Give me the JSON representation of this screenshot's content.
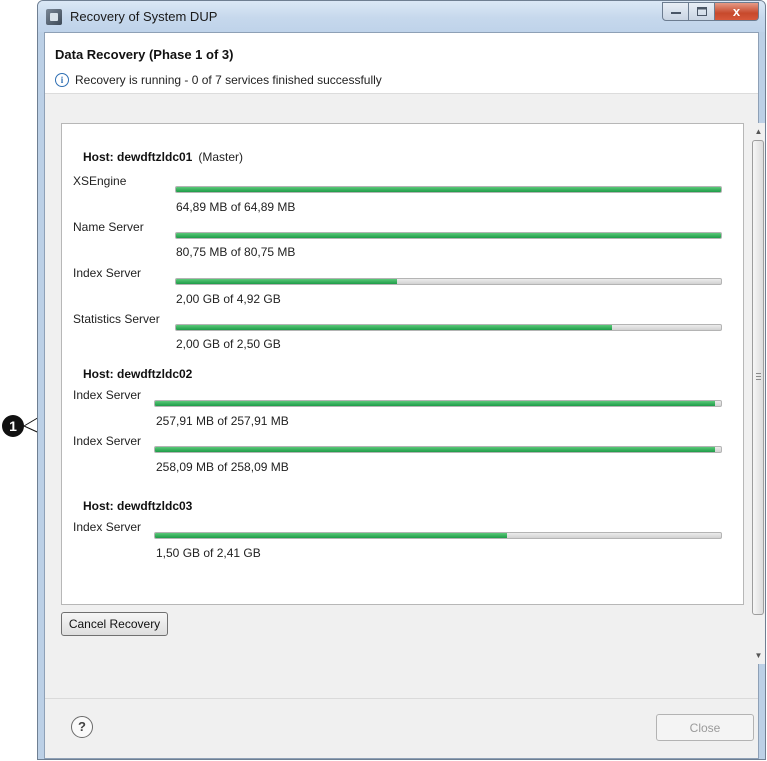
{
  "window": {
    "title": "Recovery of System DUP"
  },
  "header": {
    "title": "Data Recovery (Phase 1 of 3)",
    "message": "Recovery is running - 0 of 7 services finished successfully"
  },
  "callout": {
    "label": "1"
  },
  "hosts": [
    {
      "title": "Host: dewdftzldc01",
      "role": "(Master)",
      "services": [
        {
          "name": "XSEngine",
          "amount": "64,89 MB of 64,89 MB",
          "progress": 1.0
        },
        {
          "name": "Name Server",
          "amount": "80,75 MB of 80,75 MB",
          "progress": 1.0
        },
        {
          "name": "Index Server",
          "amount": "2,00 GB of 4,92 GB",
          "progress": 0.406
        },
        {
          "name": "Statistics Server",
          "amount": "2,00 GB of 2,50 GB",
          "progress": 0.8
        }
      ]
    },
    {
      "title": "Host: dewdftzldc02",
      "services": [
        {
          "name": "Index Server",
          "amount": "257,91 MB of 257,91 MB",
          "progress": 0.99
        },
        {
          "name": "Index Server",
          "amount": "258,09 MB of 258,09 MB",
          "progress": 0.99
        }
      ]
    },
    {
      "title": "Host: dewdftzldc03",
      "services": [
        {
          "name": "Index Server",
          "amount": "1,50 GB of 2,41 GB",
          "progress": 0.622
        }
      ]
    }
  ],
  "buttons": {
    "cancel": "Cancel Recovery",
    "close": "Close",
    "help": "?"
  },
  "window_controls": {
    "close": "x"
  },
  "colors": {
    "progress_fill": "#1e9c48",
    "info": "#2f6fb3"
  }
}
